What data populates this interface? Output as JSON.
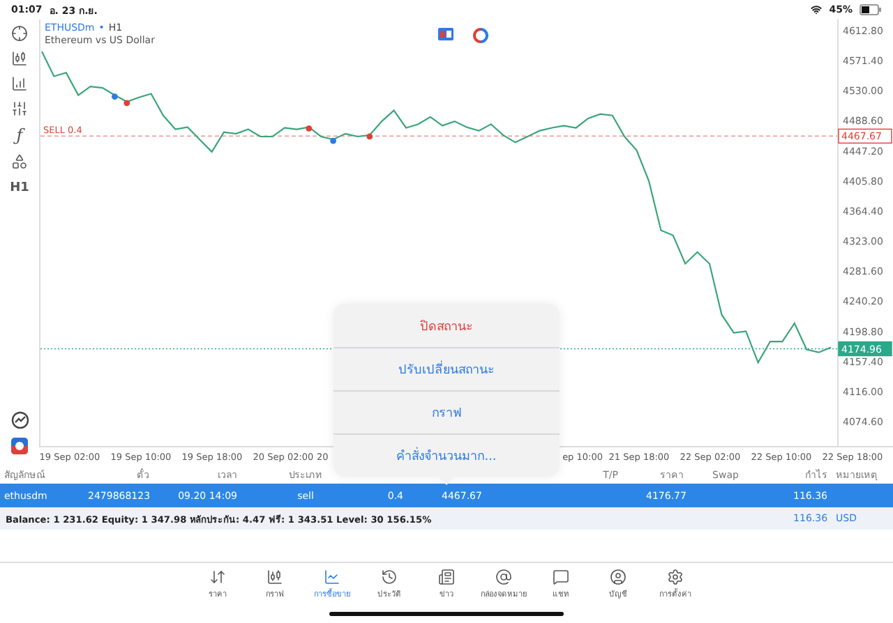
{
  "status_bar": {
    "time": "01:07",
    "date": "อ. 23 ก.ย.",
    "battery": "45%"
  },
  "toolbar": {
    "function_label": "ƒ",
    "timeframe": "H1"
  },
  "chart": {
    "separator": "•",
    "timeframe": "H1",
    "description": "Ethereum vs US Dollar",
    "sell_label": "SELL 0.4",
    "time_axis": [
      "19 Sep 02:00",
      "19 Sep 10:00",
      "19 Sep 18:00",
      "20 Sep 02:00",
      "20",
      "ep 10:00",
      "21 Sep 18:00",
      "22 Sep 02:00",
      "22 Sep 10:00",
      "22 Sep 18:00"
    ],
    "trade_marks": [
      {
        "color": "#2c7be5"
      },
      {
        "color": "#e0403a"
      },
      {
        "color": "#e0403a"
      },
      {
        "color": "#2c7be5"
      },
      {
        "color": "#e0403a"
      }
    ],
    "chart_data": {
      "type": "line",
      "series": [
        {
          "name": "ETHUSDm",
          "color": "#3aa57a",
          "values": [
            4584,
            4550,
            4555,
            4524,
            4536,
            4534,
            4524,
            4515,
            4521,
            4526,
            4496,
            4477,
            4480,
            4463,
            4446,
            4473,
            4471,
            4477,
            4467,
            4467,
            4479,
            4477,
            4480,
            4467,
            4463,
            4471,
            4467,
            4469,
            4488,
            4503,
            4479,
            4484,
            4494,
            4482,
            4488,
            4480,
            4475,
            4484,
            4469,
            4459,
            4467,
            4475,
            4479,
            4482,
            4479,
            4492,
            4498,
            4496,
            4467,
            4448,
            4406,
            4338,
            4331,
            4292,
            4308,
            4292,
            4222,
            4197,
            4199,
            4156,
            4185,
            4185,
            4210,
            4174,
            4170,
            4177
          ]
        }
      ],
      "ylim": [
        4041.2,
        4628.1
      ],
      "yticks": [
        {
          "value": 4612.8,
          "label": "4612.80"
        },
        {
          "value": 4571.4,
          "label": "4571.40"
        },
        {
          "value": 4530,
          "label": "4530.00"
        },
        {
          "value": 4488.6,
          "label": "4488.60"
        },
        {
          "value": 4447.2,
          "label": "4447.20"
        },
        {
          "value": 4405.8,
          "label": "4405.80"
        },
        {
          "value": 4364.4,
          "label": "4364.40"
        },
        {
          "value": 4323,
          "label": "4323.00"
        },
        {
          "value": 4281.6,
          "label": "4281.60"
        },
        {
          "value": 4240.2,
          "label": "4240.20"
        },
        {
          "value": 4198.8,
          "label": "4198.80"
        },
        {
          "value": 4157.4,
          "label": "4157.40"
        },
        {
          "value": 4116,
          "label": "4116.00"
        },
        {
          "value": 4074.6,
          "label": "4074.60"
        }
      ],
      "ref_lines": [
        {
          "axis": "y",
          "value": 4467.67,
          "label": "4467.67",
          "color": "#e0403a"
        },
        {
          "axis": "y",
          "value": 4174.96,
          "label": "4174.96",
          "color": "#2aa88a"
        }
      ]
    }
  },
  "table": {
    "columns": [
      {
        "label": "สัญลักษณ์"
      },
      {
        "label": "ตั๋ว"
      },
      {
        "label": "เวลา"
      },
      {
        "label": "ประเภท"
      },
      {},
      {},
      {},
      {
        "label": "T/P"
      },
      {
        "label": "ราคา"
      },
      {
        "label": "Swap"
      },
      {
        "label": "กำไร"
      },
      {
        "label": "หมายเหตุ"
      }
    ],
    "rows": [
      {
        "selected": true,
        "cells": [
          "ethusdm",
          "2479868123",
          "09.20 14:09",
          "sell",
          "0.4",
          "4467.67",
          null,
          null,
          "4176.77",
          null,
          "116.36",
          null
        ]
      }
    ]
  },
  "summary": {
    "text": "Balance: 1 231.62 Equity: 1 347.98 หลักประกัน: 4.47 ฟรี: 1 343.51 Level: 30 156.15%",
    "profit": "116.36",
    "currency": "USD"
  },
  "popup_menu": [
    {
      "label": "ปิดสถานะ",
      "kind": "destructive"
    },
    {
      "label": "ปรับเปลี่ยนสถานะ",
      "kind": "default"
    },
    {
      "label": "กราฟ",
      "kind": "default"
    },
    {
      "label": "คำสั่งจำนวนมาก...",
      "kind": "default"
    }
  ],
  "tab_bar": [
    {
      "label": "ราคา",
      "selected": false
    },
    {
      "label": "กราฟ",
      "selected": false
    },
    {
      "label": "การซื้อขาย",
      "selected": true
    },
    {
      "label": "ประวัติ",
      "selected": false
    },
    {
      "label": "ข่าว",
      "selected": false
    },
    {
      "label": "กล่องจดหมาย",
      "selected": false
    },
    {
      "label": "แชท",
      "selected": false
    },
    {
      "label": "บัญชี",
      "selected": false
    },
    {
      "label": "การตั้งค่า",
      "selected": false
    }
  ]
}
